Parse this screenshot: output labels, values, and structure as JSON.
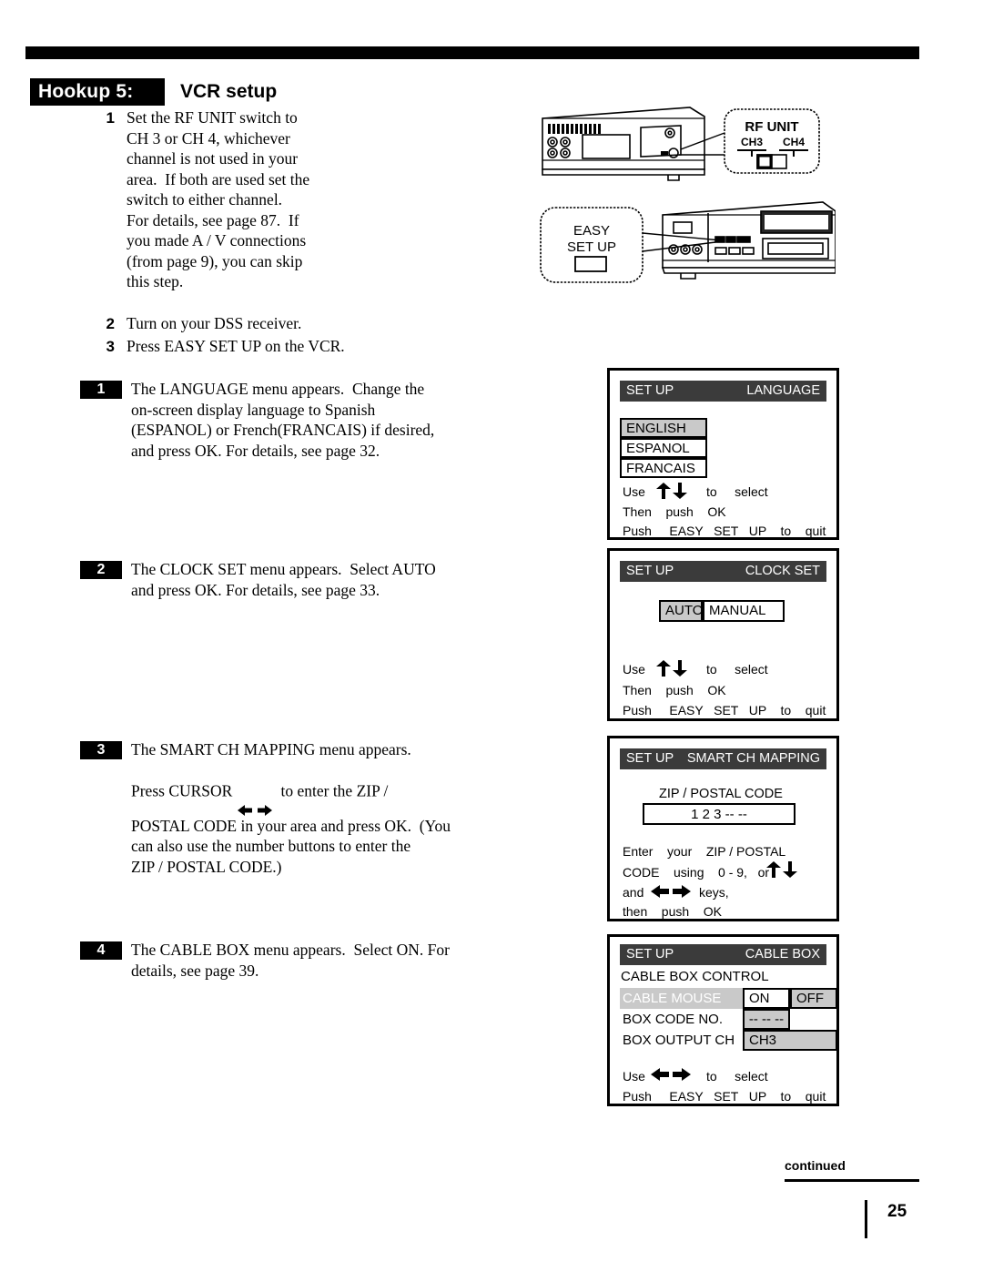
{
  "header": {
    "badge": "Hookup 5:",
    "title": "VCR setup"
  },
  "steps": [
    {
      "num": "1",
      "lines": [
        "Set the RF UNIT switch to",
        "CH 3 or CH 4, whichever",
        "channel is not used in your",
        "area.  If both are used set the",
        "switch to either channel.",
        "For details, see page 87.  If",
        "you made A / V connections",
        "(from page 9), you can skip",
        "this step."
      ]
    },
    {
      "num": "2",
      "lines": [
        "Turn on your DSS receiver."
      ]
    },
    {
      "num": "3",
      "lines": [
        "Press EASY SET UP on the VCR."
      ]
    }
  ],
  "substeps": [
    {
      "num": "1",
      "lines": [
        "The LANGUAGE menu appears.  Change the",
        "on-screen display language to Spanish",
        "(ESPANOL) or French(FRANCAIS) if desired,",
        "and press OK. For details, see page 32."
      ]
    },
    {
      "num": "2",
      "lines": [
        "The CLOCK SET menu appears.  Select AUTO",
        "and press OK. For details, see page 33."
      ]
    },
    {
      "num": "3",
      "line_a": "The SMART CH MAPPING menu appears.",
      "line_b_pre": "Press CURSOR ",
      "line_b_post": "  to enter the ZIP /",
      "lines_rest": [
        "POSTAL CODE in your area and press OK.  (You",
        "can also use the number buttons to enter the",
        "ZIP / POSTAL CODE.)"
      ]
    },
    {
      "num": "4",
      "lines": [
        "The CABLE BOX menu appears.  Select ON. For",
        "details, see page 39."
      ]
    }
  ],
  "illustration": {
    "rf_unit_label": "RF UNIT",
    "ch3_label": "CH3",
    "ch4_label": "CH4",
    "easy_label_line1": "EASY",
    "easy_label_line2": "SET UP"
  },
  "osd_screens": [
    {
      "id": "language",
      "title_left": "SET UP",
      "title_right": "LANGUAGE",
      "options": [
        "ENGLISH",
        "ESPANOL",
        "FRANCAIS"
      ],
      "selected": "ENGLISH",
      "hints": [
        "Use",
        "to     select",
        "Then    push    OK",
        "Push     EASY   SET   UP    to    quit"
      ]
    },
    {
      "id": "clock_set",
      "title_left": "SET UP",
      "title_right": "CLOCK SET",
      "options": [
        "AUTO",
        "MANUAL"
      ],
      "selected": "AUTO",
      "hints": [
        "Use",
        "to     select",
        "Then    push    OK",
        "Push     EASY   SET   UP    to    quit"
      ]
    },
    {
      "id": "smart_ch_mapping",
      "title_left": "SET UP",
      "title_right": "SMART CH MAPPING",
      "field_label": "ZIP / POSTAL CODE",
      "field_value": "1  2  3  --  --",
      "hints": [
        "Enter    your    ZIP / POSTAL",
        "CODE    using    0 - 9,   or",
        "and",
        "keys,",
        "then    push    OK"
      ]
    },
    {
      "id": "cable_box",
      "title_left": "SET UP",
      "title_right": "CABLE BOX",
      "section_label": "CABLE BOX CONTROL",
      "rows": [
        {
          "label": "CABLE MOUSE",
          "value_on": "ON",
          "value_off": "OFF"
        },
        {
          "label": "BOX CODE NO.",
          "value": "-- -- --"
        },
        {
          "label": "BOX OUTPUT CH",
          "value": "CH3"
        }
      ],
      "hints": [
        "Use",
        "to     select",
        "Push     EASY   SET   UP    to    quit"
      ]
    }
  ],
  "footer": {
    "continued": "continued",
    "page_number": "25"
  },
  "colors": {
    "ink": "#000000",
    "titlebar": "#3b3b3b",
    "highlight": "#c9c9c9"
  }
}
